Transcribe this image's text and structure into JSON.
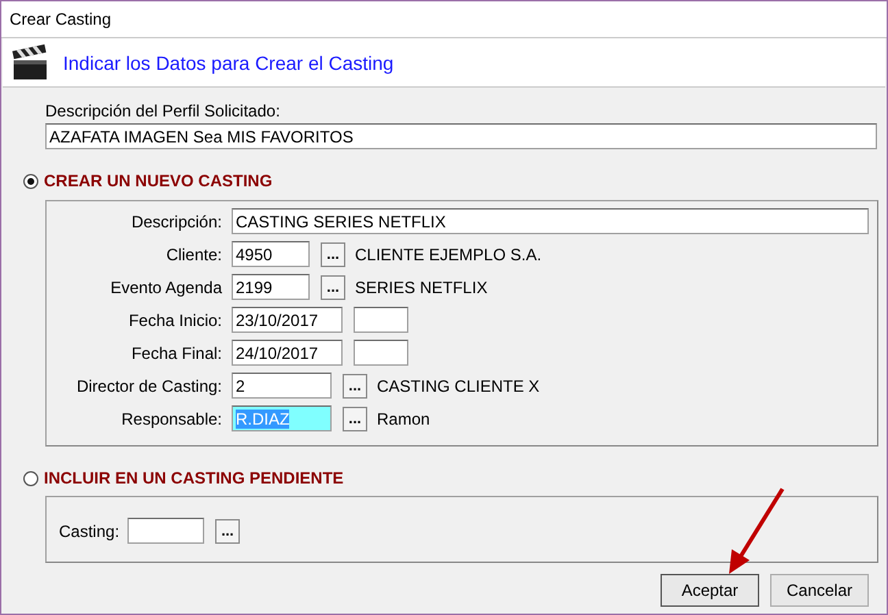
{
  "window": {
    "title": "Crear Casting"
  },
  "header": {
    "title": "Indicar los Datos para Crear el Casting"
  },
  "profile": {
    "label": "Descripción del Perfil Solicitado:",
    "value": "AZAFATA IMAGEN Sea MIS FAVORITOS"
  },
  "options": [
    {
      "label": "CREAR UN NUEVO CASTING",
      "selected": true,
      "fields": [
        {
          "kind": "text",
          "label": "Descripción:",
          "value": "CASTING SERIES NETFLIX"
        },
        {
          "kind": "lookup",
          "label": "Cliente:",
          "value": "4950",
          "button": "...",
          "description": "CLIENTE EJEMPLO S.A.",
          "highlighted": false
        },
        {
          "kind": "lookup",
          "label": "Evento Agenda",
          "value": "2199",
          "button": "...",
          "description": "SERIES NETFLIX",
          "highlighted": false
        },
        {
          "kind": "date",
          "label": "Fecha Inicio:",
          "value": "23/10/2017"
        },
        {
          "kind": "date",
          "label": "Fecha Final:",
          "value": "24/10/2017"
        },
        {
          "kind": "lookup-wide",
          "label": "Director de Casting:",
          "value": "2",
          "button": "...",
          "description": "CASTING CLIENTE X",
          "highlighted": false
        },
        {
          "kind": "lookup-wide",
          "label": "Responsable:",
          "value": "R.DIAZ",
          "button": "...",
          "description": "Ramon",
          "highlighted": true
        }
      ]
    },
    {
      "label": "INCLUIR EN UN CASTING PENDIENTE",
      "selected": false,
      "fields": [
        {
          "kind": "inline-lookup",
          "label": "Casting:",
          "button": "..."
        }
      ]
    }
  ],
  "buttons": [
    "Aceptar",
    "Cancelar"
  ]
}
